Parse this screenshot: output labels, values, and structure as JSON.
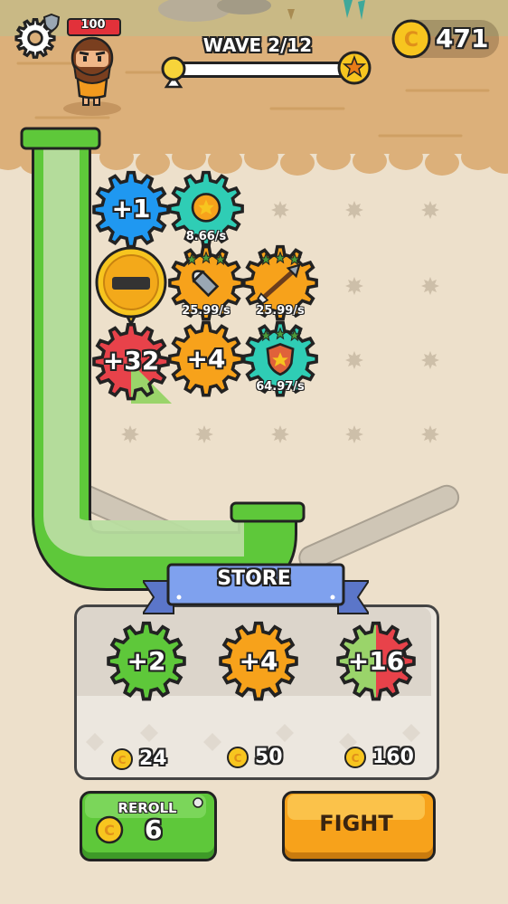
{
  "hud": {
    "hp": "100",
    "wave_label": "WAVE 2/12",
    "coins": "471",
    "wave_progress": 0.0
  },
  "board": {
    "gears": [
      {
        "id": "plus1",
        "label": "+1",
        "color": "blue"
      },
      {
        "id": "coin-gear",
        "label": "",
        "rate": "8.66/s",
        "color": "teal",
        "icon": "coin-icon"
      },
      {
        "id": "locked",
        "label": "",
        "color": "gold",
        "icon": "lock-slot-icon"
      },
      {
        "id": "bullet-gear",
        "label": "",
        "rate": "25.99/s",
        "color": "orange",
        "icon": "bullet-icon"
      },
      {
        "id": "arrow-gear",
        "label": "",
        "rate": "25.99/s",
        "color": "orange",
        "icon": "arrow-icon"
      },
      {
        "id": "plus32",
        "label": "+32",
        "color": "red-green"
      },
      {
        "id": "plus4",
        "label": "+4",
        "color": "orange"
      },
      {
        "id": "shield-gear",
        "label": "",
        "rate": "64.97/s",
        "color": "teal",
        "icon": "shield-icon"
      }
    ]
  },
  "store": {
    "title": "STORE",
    "items": [
      {
        "label": "+2",
        "price": "24",
        "color": "green"
      },
      {
        "label": "+4",
        "price": "50",
        "color": "orange"
      },
      {
        "label": "+16",
        "price": "160",
        "color": "red-green"
      }
    ]
  },
  "buttons": {
    "reroll_label": "REROLL",
    "reroll_cost": "6",
    "fight_label": "FIGHT"
  },
  "colors": {
    "sand": "#dcb07a",
    "board": "#ede0cb",
    "green": "#5ec83a",
    "orange": "#f7a21b",
    "teal": "#2fcdb5",
    "blue": "#1f98f1",
    "red": "#e8424a",
    "gold": "#f7c51f"
  }
}
